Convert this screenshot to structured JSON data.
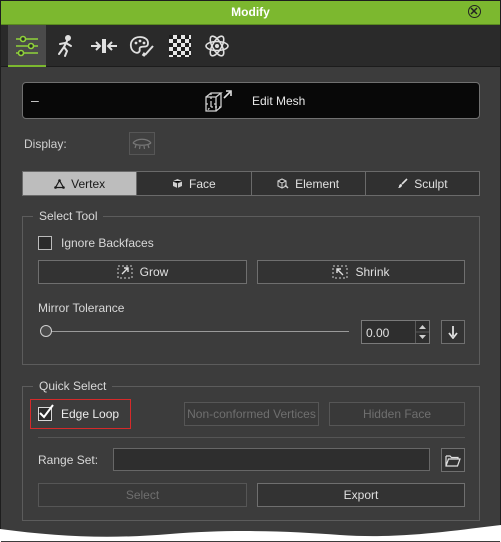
{
  "window": {
    "title": "Modify"
  },
  "tabs": [
    {
      "icon": "sliders-icon",
      "active": true
    },
    {
      "icon": "pose-figure-icon",
      "active": false
    },
    {
      "icon": "morph-arrows-icon",
      "active": false
    },
    {
      "icon": "palette-icon",
      "active": false
    },
    {
      "icon": "checker-texture-icon",
      "active": false
    },
    {
      "icon": "atom-icon",
      "active": false
    }
  ],
  "edit_mesh": {
    "collapse": "–",
    "label": "Edit Mesh"
  },
  "display": {
    "label": "Display:"
  },
  "modes": [
    {
      "label": "Vertex",
      "icon": "vertex-icon",
      "active": true
    },
    {
      "label": "Face",
      "icon": "face-icon",
      "active": false
    },
    {
      "label": "Element",
      "icon": "element-icon",
      "active": false
    },
    {
      "label": "Sculpt",
      "icon": "brush-icon",
      "active": false
    }
  ],
  "select_tool": {
    "legend": "Select Tool",
    "ignore_backfaces": {
      "label": "Ignore Backfaces",
      "checked": false
    },
    "grow_label": "Grow",
    "shrink_label": "Shrink",
    "mirror_tolerance_label": "Mirror Tolerance",
    "mirror_tolerance_value": "0.00",
    "slider_fraction": 0
  },
  "quick_select": {
    "legend": "Quick Select",
    "edge_loop": {
      "label": "Edge Loop",
      "checked": true
    },
    "non_conformed_label": "Non-conformed Vertices",
    "hidden_face_label": "Hidden Face",
    "range_set_label": "Range Set:",
    "range_set_value": "",
    "select_label": "Select",
    "export_label": "Export"
  },
  "colors": {
    "accent": "#7cb82f",
    "highlight": "#d62a2a"
  }
}
